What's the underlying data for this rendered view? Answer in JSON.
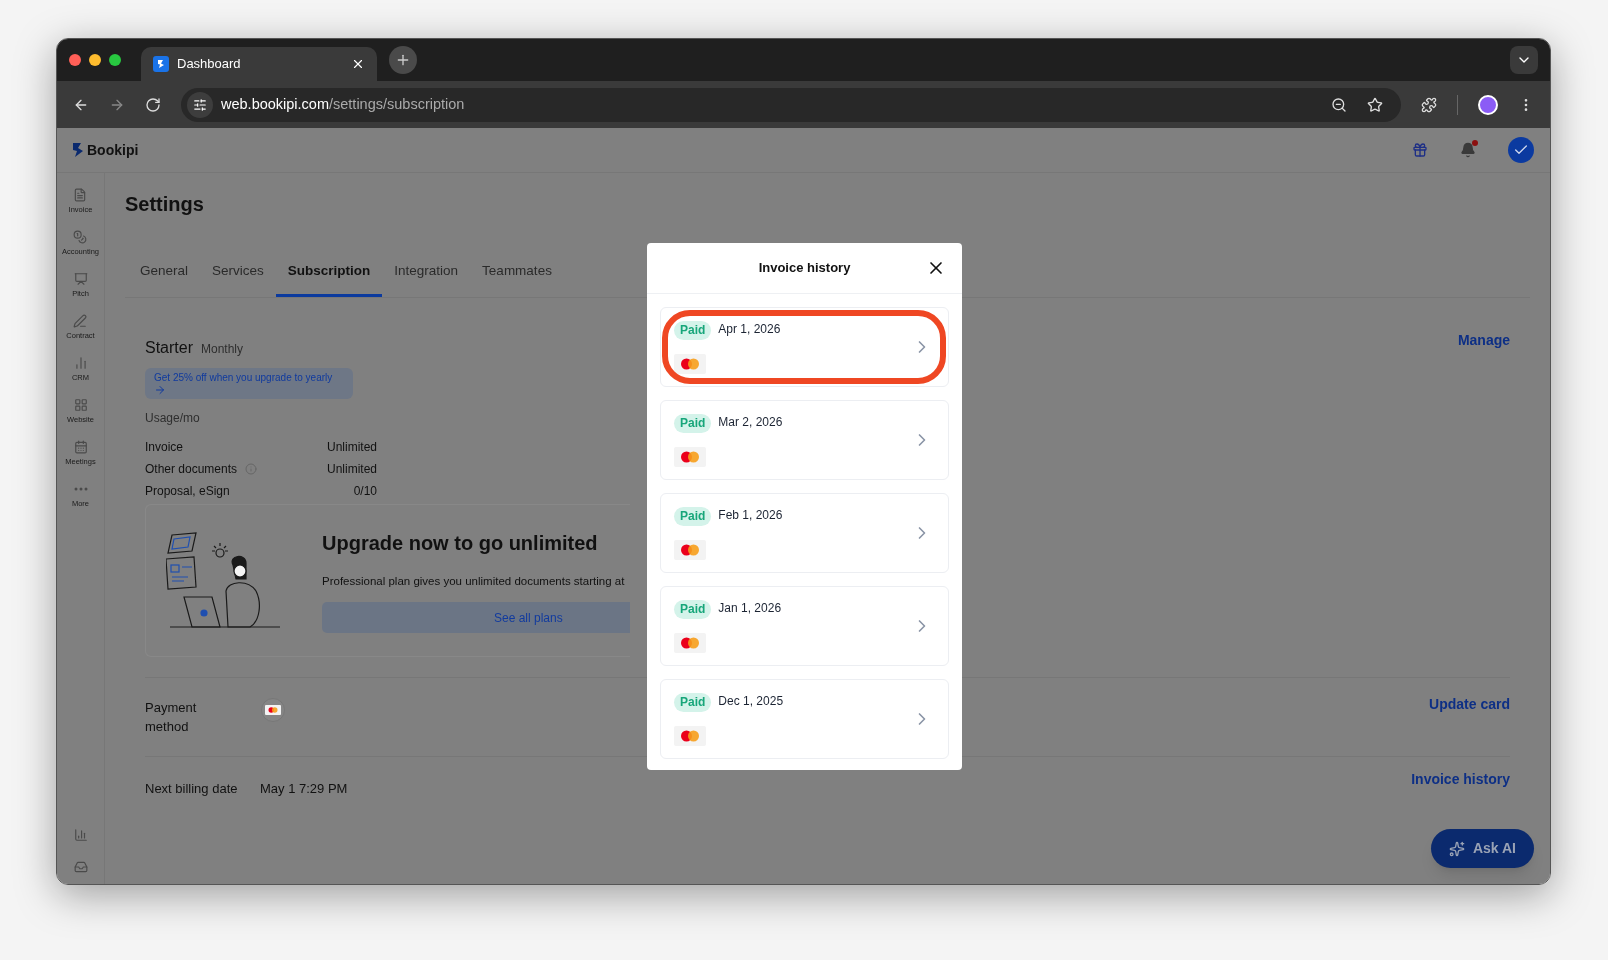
{
  "browser": {
    "tabs": [
      {
        "title": "Dashboard",
        "selected": true
      }
    ],
    "url_host": "web.bookipi.com",
    "url_path": "/settings/subscription"
  },
  "app": {
    "brand": "Bookipi",
    "notifications_unread": true
  },
  "sidebar": {
    "items": [
      {
        "label": "Invoice",
        "kind": "invoice"
      },
      {
        "label": "Accounting",
        "kind": "accounting"
      },
      {
        "label": "Pitch",
        "kind": "pitch"
      },
      {
        "label": "Contract",
        "kind": "contract"
      },
      {
        "label": "CRM",
        "kind": "crm"
      },
      {
        "label": "Website",
        "kind": "website"
      },
      {
        "label": "Meetings",
        "kind": "meetings"
      },
      {
        "label": "More",
        "kind": "more"
      }
    ]
  },
  "settings": {
    "title": "Settings",
    "tabs": [
      {
        "label": "General",
        "selected": false
      },
      {
        "label": "Services",
        "selected": false
      },
      {
        "label": "Subscription",
        "selected": true
      },
      {
        "label": "Integration",
        "selected": false
      },
      {
        "label": "Teammates",
        "selected": false
      }
    ],
    "plan": {
      "name": "Starter",
      "period": "Monthly",
      "promo": "Get 25% off when you upgrade to yearly",
      "action": "Manage"
    },
    "usage": {
      "title": "Usage/mo",
      "rows": [
        {
          "label": "Invoice",
          "value": "Unlimited",
          "info": false
        },
        {
          "label": "Other documents",
          "value": "Unlimited",
          "info": true
        },
        {
          "label": "Proposal, eSign",
          "value": "0/10",
          "info": false
        }
      ]
    },
    "upgrade": {
      "title": "Upgrade now to go unlimited",
      "text": "Professional plan gives you unlimited documents starting at",
      "button": "See all plans"
    },
    "payment": {
      "label": "Payment method",
      "action": "Update card"
    },
    "billing": {
      "label": "Next billing date",
      "value": "May 1 7:29 PM",
      "action": "Invoice history"
    },
    "ask_ai": "Ask AI"
  },
  "modal": {
    "title": "Invoice history",
    "invoices": [
      {
        "status": "Paid",
        "date": "Apr 1, 2026",
        "annotated": true
      },
      {
        "status": "Paid",
        "date": "Mar 2, 2026",
        "annotated": false
      },
      {
        "status": "Paid",
        "date": "Feb 1, 2026",
        "annotated": false
      },
      {
        "status": "Paid",
        "date": "Jan 1, 2026",
        "annotated": false
      },
      {
        "status": "Paid",
        "date": "Dec 1, 2025",
        "annotated": false
      }
    ]
  }
}
